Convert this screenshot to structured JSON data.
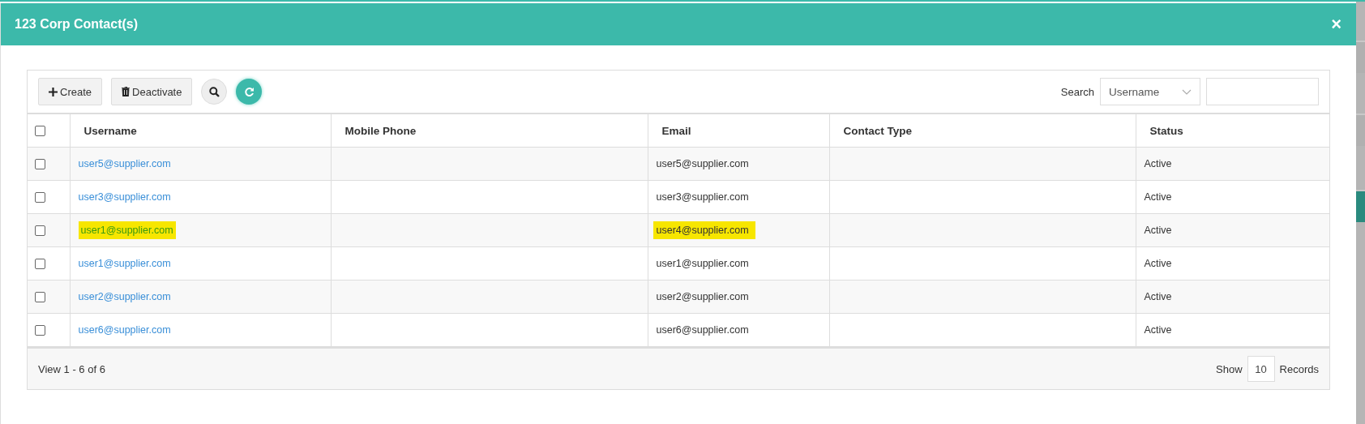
{
  "modal": {
    "title": "123 Corp Contact(s)",
    "close": "×"
  },
  "toolbar": {
    "buttons": [
      {
        "kind": "create",
        "label": "Create"
      },
      {
        "kind": "deactivate",
        "label": "Deactivate"
      },
      {
        "kind": "search"
      },
      {
        "kind": "refresh"
      }
    ],
    "search_label": "Search",
    "search_field": {
      "value": "Username"
    }
  },
  "table": {
    "select_all": {
      "checked": false
    },
    "columns": [
      "Username",
      "Mobile Phone",
      "Email",
      "Contact Type",
      "Status"
    ],
    "rows": [
      {
        "checked": false,
        "username": {
          "text": "user5@supplier.com",
          "highlighted": false
        },
        "email": {
          "text": "user5@supplier.com",
          "highlighted": false
        },
        "status": "Active"
      },
      {
        "checked": false,
        "username": {
          "text": "user3@supplier.com",
          "highlighted": false
        },
        "email": {
          "text": "user3@supplier.com",
          "highlighted": false
        },
        "status": "Active"
      },
      {
        "checked": false,
        "username": {
          "text": "user1@supplier.com",
          "highlighted": true
        },
        "email": {
          "text": "user4@supplier.com",
          "highlighted": true
        },
        "status": "Active"
      },
      {
        "checked": false,
        "username": {
          "text": "user1@supplier.com",
          "highlighted": false
        },
        "email": {
          "text": "user1@supplier.com",
          "highlighted": false
        },
        "status": "Active"
      },
      {
        "checked": false,
        "username": {
          "text": "user2@supplier.com",
          "highlighted": false
        },
        "email": {
          "text": "user2@supplier.com",
          "highlighted": false
        },
        "status": "Active"
      },
      {
        "checked": false,
        "username": {
          "text": "user6@supplier.com",
          "highlighted": false
        },
        "email": {
          "text": "user6@supplier.com",
          "highlighted": false
        },
        "status": "Active"
      }
    ]
  },
  "footer": {
    "view_info": "View 1 - 6 of 6",
    "show_label": "Show",
    "page_size": "10",
    "records_label": "Records"
  }
}
